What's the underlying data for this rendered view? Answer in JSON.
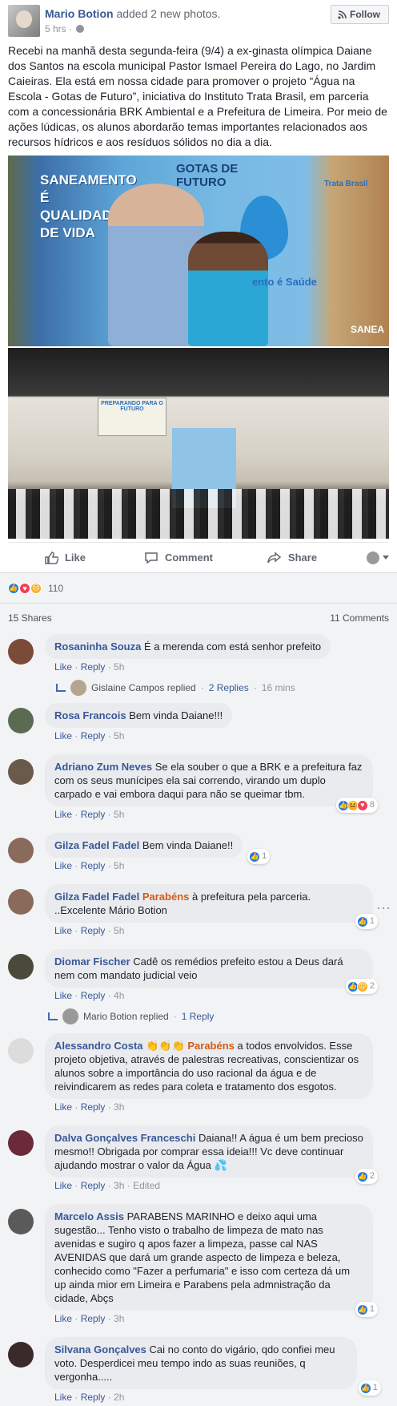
{
  "post": {
    "author": "Mario Botion",
    "action_text": "added 2 new photos.",
    "time": "5 hrs",
    "follow_label": "Follow",
    "text": "Recebi na manhã desta segunda-feira (9/4) a ex-ginasta olímpica Daiane dos Santos na escola municipal Pastor Ismael Pereira do Lago, no Jardim Caieiras. Ela está em nossa cidade para promover o projeto “Água na Escola - Gotas de Futuro”, iniciativa do Instituto Trata Brasil, em parceria com a concessionária BRK Ambiental e a Prefeitura de Limeira. Por meio de ações lúdicas, os alunos abordarão temas importantes relacionados aos recursos hídricos e aos resíduos sólidos no dia a dia.",
    "photo1_text": {
      "left": "SANEAMENTO É QUALIDADE DE VIDA",
      "center": "GOTAS DE FUTURO",
      "right": "Trata Brasil",
      "bottom": "ento é Saúde",
      "saneam": "SANEA"
    },
    "photo2_text": {
      "banner": "PREPARANDO PARA O FUTURO"
    }
  },
  "actions": {
    "like": "Like",
    "comment": "Comment",
    "share": "Share"
  },
  "reactions": {
    "count": "110",
    "shares": "15 Shares",
    "comments_count": "11 Comments"
  },
  "comments": [
    {
      "name": "Rosaninha Souza",
      "text": "É a merenda com está senhor prefeito",
      "like": "Like",
      "reply": "Reply",
      "time": "5h",
      "reply_by": "Gislaine Campos replied",
      "replies": "2 Replies",
      "reply_time": "16 mins"
    },
    {
      "name": "Rosa Francois",
      "text": "Bem vinda Daiane!!!",
      "like": "Like",
      "reply": "Reply",
      "time": "5h"
    },
    {
      "name": "Adriano Zum Neves",
      "text": "Se ela souber o que a BRK e a prefeitura faz com os seus munícipes ela sai correndo, virando um duplo carpado e vai embora daqui para não se queimar tbm.",
      "like": "Like",
      "reply": "Reply",
      "time": "5h",
      "rx": "8"
    },
    {
      "name": "Gilza Fadel Fadel",
      "text": "Bem vinda Daiane!!",
      "like": "Like",
      "reply": "Reply",
      "time": "5h",
      "rx": "1"
    },
    {
      "name": "Gilza Fadel Fadel",
      "tag": "Parabéns",
      "text": "à prefeitura pela parceria. ..Excelente Mário Botion",
      "like": "Like",
      "reply": "Reply",
      "time": "5h",
      "rx": "1"
    },
    {
      "name": "Diomar Fischer",
      "text": "Cadê os remédios prefeito estou a Deus dará nem com mandato judicial veio",
      "like": "Like",
      "reply": "Reply",
      "time": "4h",
      "rx": "2",
      "reply_by": "Mario Botion replied",
      "replies": "1 Reply"
    },
    {
      "name": "Alessandro Costa",
      "emoji": "👏👏👏",
      "tag": "Parabéns",
      "text": "a todos envolvidos. Esse projeto objetiva, através de palestras recreativas, conscientizar os alunos sobre a importância do uso racional da água e de reivindicarem as redes para coleta e tratamento dos esgotos.",
      "like": "Like",
      "reply": "Reply",
      "time": "3h"
    },
    {
      "name": "Dalva Gonçalves Franceschi",
      "text": "Daiana!! A água é um bem precioso mesmo!! Obrigada por comprar essa ideia!!! Vc deve continuar ajudando mostrar o valor da Água 💦",
      "like": "Like",
      "reply": "Reply",
      "time": "3h",
      "edited": "Edited",
      "rx": "2"
    },
    {
      "name": "Marcelo Assis",
      "text": "PARABENS MARINHO e deixo aqui uma sugestão... Tenho visto o trabalho de limpeza de mato nas avenidas e sugiro q apos fazer a limpeza, passe cal NAS AVENIDAS que dará um grande aspecto de limpeza e beleza, conhecido como \"Fazer a perfumaria\" e isso com certeza dá um up ainda mior em Limeira e Parabens pela admnistração da cidade, Abçs",
      "like": "Like",
      "reply": "Reply",
      "time": "3h",
      "rx": "1"
    },
    {
      "name": "Silvana Gonçalves",
      "text": "Cai no conto do vigário, qdo confiei meu voto. Desperdicei meu tempo indo as suas reuniões, q vergonha.....",
      "like": "Like",
      "reply": "Reply",
      "time": "2h",
      "rx": "1"
    }
  ]
}
